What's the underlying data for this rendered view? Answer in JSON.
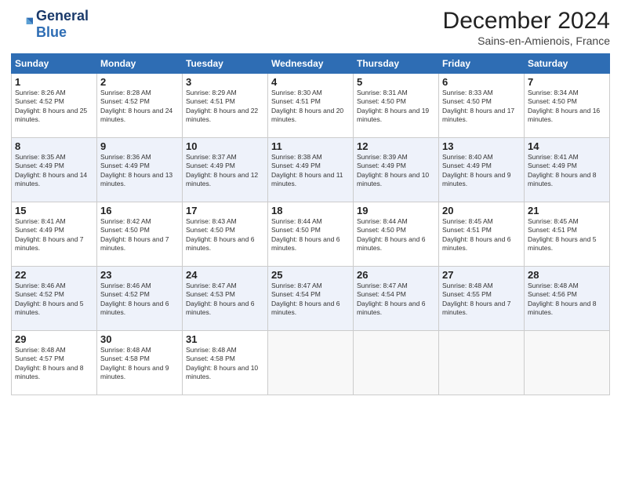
{
  "header": {
    "logo_line1": "General",
    "logo_line2": "Blue",
    "month": "December 2024",
    "location": "Sains-en-Amienois, France"
  },
  "weekdays": [
    "Sunday",
    "Monday",
    "Tuesday",
    "Wednesday",
    "Thursday",
    "Friday",
    "Saturday"
  ],
  "weeks": [
    [
      {
        "day": "1",
        "sunrise": "Sunrise: 8:26 AM",
        "sunset": "Sunset: 4:52 PM",
        "daylight": "Daylight: 8 hours and 25 minutes."
      },
      {
        "day": "2",
        "sunrise": "Sunrise: 8:28 AM",
        "sunset": "Sunset: 4:52 PM",
        "daylight": "Daylight: 8 hours and 24 minutes."
      },
      {
        "day": "3",
        "sunrise": "Sunrise: 8:29 AM",
        "sunset": "Sunset: 4:51 PM",
        "daylight": "Daylight: 8 hours and 22 minutes."
      },
      {
        "day": "4",
        "sunrise": "Sunrise: 8:30 AM",
        "sunset": "Sunset: 4:51 PM",
        "daylight": "Daylight: 8 hours and 20 minutes."
      },
      {
        "day": "5",
        "sunrise": "Sunrise: 8:31 AM",
        "sunset": "Sunset: 4:50 PM",
        "daylight": "Daylight: 8 hours and 19 minutes."
      },
      {
        "day": "6",
        "sunrise": "Sunrise: 8:33 AM",
        "sunset": "Sunset: 4:50 PM",
        "daylight": "Daylight: 8 hours and 17 minutes."
      },
      {
        "day": "7",
        "sunrise": "Sunrise: 8:34 AM",
        "sunset": "Sunset: 4:50 PM",
        "daylight": "Daylight: 8 hours and 16 minutes."
      }
    ],
    [
      {
        "day": "8",
        "sunrise": "Sunrise: 8:35 AM",
        "sunset": "Sunset: 4:49 PM",
        "daylight": "Daylight: 8 hours and 14 minutes."
      },
      {
        "day": "9",
        "sunrise": "Sunrise: 8:36 AM",
        "sunset": "Sunset: 4:49 PM",
        "daylight": "Daylight: 8 hours and 13 minutes."
      },
      {
        "day": "10",
        "sunrise": "Sunrise: 8:37 AM",
        "sunset": "Sunset: 4:49 PM",
        "daylight": "Daylight: 8 hours and 12 minutes."
      },
      {
        "day": "11",
        "sunrise": "Sunrise: 8:38 AM",
        "sunset": "Sunset: 4:49 PM",
        "daylight": "Daylight: 8 hours and 11 minutes."
      },
      {
        "day": "12",
        "sunrise": "Sunrise: 8:39 AM",
        "sunset": "Sunset: 4:49 PM",
        "daylight": "Daylight: 8 hours and 10 minutes."
      },
      {
        "day": "13",
        "sunrise": "Sunrise: 8:40 AM",
        "sunset": "Sunset: 4:49 PM",
        "daylight": "Daylight: 8 hours and 9 minutes."
      },
      {
        "day": "14",
        "sunrise": "Sunrise: 8:41 AM",
        "sunset": "Sunset: 4:49 PM",
        "daylight": "Daylight: 8 hours and 8 minutes."
      }
    ],
    [
      {
        "day": "15",
        "sunrise": "Sunrise: 8:41 AM",
        "sunset": "Sunset: 4:49 PM",
        "daylight": "Daylight: 8 hours and 7 minutes."
      },
      {
        "day": "16",
        "sunrise": "Sunrise: 8:42 AM",
        "sunset": "Sunset: 4:50 PM",
        "daylight": "Daylight: 8 hours and 7 minutes."
      },
      {
        "day": "17",
        "sunrise": "Sunrise: 8:43 AM",
        "sunset": "Sunset: 4:50 PM",
        "daylight": "Daylight: 8 hours and 6 minutes."
      },
      {
        "day": "18",
        "sunrise": "Sunrise: 8:44 AM",
        "sunset": "Sunset: 4:50 PM",
        "daylight": "Daylight: 8 hours and 6 minutes."
      },
      {
        "day": "19",
        "sunrise": "Sunrise: 8:44 AM",
        "sunset": "Sunset: 4:50 PM",
        "daylight": "Daylight: 8 hours and 6 minutes."
      },
      {
        "day": "20",
        "sunrise": "Sunrise: 8:45 AM",
        "sunset": "Sunset: 4:51 PM",
        "daylight": "Daylight: 8 hours and 6 minutes."
      },
      {
        "day": "21",
        "sunrise": "Sunrise: 8:45 AM",
        "sunset": "Sunset: 4:51 PM",
        "daylight": "Daylight: 8 hours and 5 minutes."
      }
    ],
    [
      {
        "day": "22",
        "sunrise": "Sunrise: 8:46 AM",
        "sunset": "Sunset: 4:52 PM",
        "daylight": "Daylight: 8 hours and 5 minutes."
      },
      {
        "day": "23",
        "sunrise": "Sunrise: 8:46 AM",
        "sunset": "Sunset: 4:52 PM",
        "daylight": "Daylight: 8 hours and 6 minutes."
      },
      {
        "day": "24",
        "sunrise": "Sunrise: 8:47 AM",
        "sunset": "Sunset: 4:53 PM",
        "daylight": "Daylight: 8 hours and 6 minutes."
      },
      {
        "day": "25",
        "sunrise": "Sunrise: 8:47 AM",
        "sunset": "Sunset: 4:54 PM",
        "daylight": "Daylight: 8 hours and 6 minutes."
      },
      {
        "day": "26",
        "sunrise": "Sunrise: 8:47 AM",
        "sunset": "Sunset: 4:54 PM",
        "daylight": "Daylight: 8 hours and 6 minutes."
      },
      {
        "day": "27",
        "sunrise": "Sunrise: 8:48 AM",
        "sunset": "Sunset: 4:55 PM",
        "daylight": "Daylight: 8 hours and 7 minutes."
      },
      {
        "day": "28",
        "sunrise": "Sunrise: 8:48 AM",
        "sunset": "Sunset: 4:56 PM",
        "daylight": "Daylight: 8 hours and 8 minutes."
      }
    ],
    [
      {
        "day": "29",
        "sunrise": "Sunrise: 8:48 AM",
        "sunset": "Sunset: 4:57 PM",
        "daylight": "Daylight: 8 hours and 8 minutes."
      },
      {
        "day": "30",
        "sunrise": "Sunrise: 8:48 AM",
        "sunset": "Sunset: 4:58 PM",
        "daylight": "Daylight: 8 hours and 9 minutes."
      },
      {
        "day": "31",
        "sunrise": "Sunrise: 8:48 AM",
        "sunset": "Sunset: 4:58 PM",
        "daylight": "Daylight: 8 hours and 10 minutes."
      },
      null,
      null,
      null,
      null
    ]
  ]
}
